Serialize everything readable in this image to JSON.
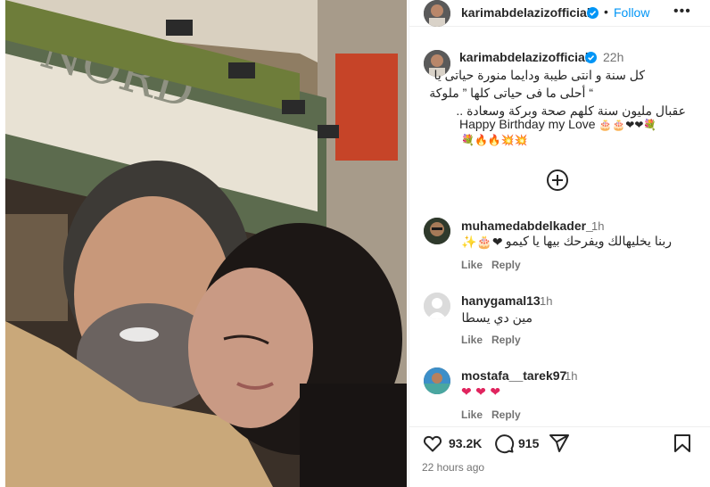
{
  "post": {
    "author": "karimabdelazizofficial",
    "follow_label": "Follow",
    "more_label": "•••",
    "separator": "•",
    "caption_time": "22h",
    "caption_lines": [
      "كل سنة و انتى طيبة ودايما منورة حياتى يا",
      "“ أحلى ما فى حياتى كلها ” ملوكة",
      "عقبال مليون سنة كلهم صحة وبركة وسعادة ..",
      "Happy Birthday my Love"
    ],
    "caption_emoji_1": "🎂🎂❤❤💐",
    "caption_emoji_2": "💐🔥🔥💥💥"
  },
  "comments": [
    {
      "username": "muhamedabdelkader_",
      "time": "1h",
      "text": "ربنا يخليهالك ويفرحك بيها يا كيمو",
      "emoji": "✨🎂❤",
      "like": "Like",
      "reply": "Reply"
    },
    {
      "username": "hanygamal13",
      "time": "1h",
      "text": "مين دي يسطا",
      "like": "Like",
      "reply": "Reply"
    },
    {
      "username": "mostafa__tarek97",
      "time": "1h",
      "text": "❤ ❤ ❤",
      "like": "Like",
      "reply": "Reply"
    }
  ],
  "stats": {
    "likes": "93.2K",
    "comments": "915",
    "time_ago": "22 hours ago"
  },
  "icons": {
    "verified": "verified-badge-icon",
    "heart": "heart-icon",
    "comment": "comment-icon",
    "share": "share-icon",
    "save": "bookmark-icon",
    "add": "load-more-comments-icon"
  },
  "colors": {
    "accent": "#0095f6",
    "text": "#262626",
    "muted": "#737373",
    "border": "#efefef"
  }
}
